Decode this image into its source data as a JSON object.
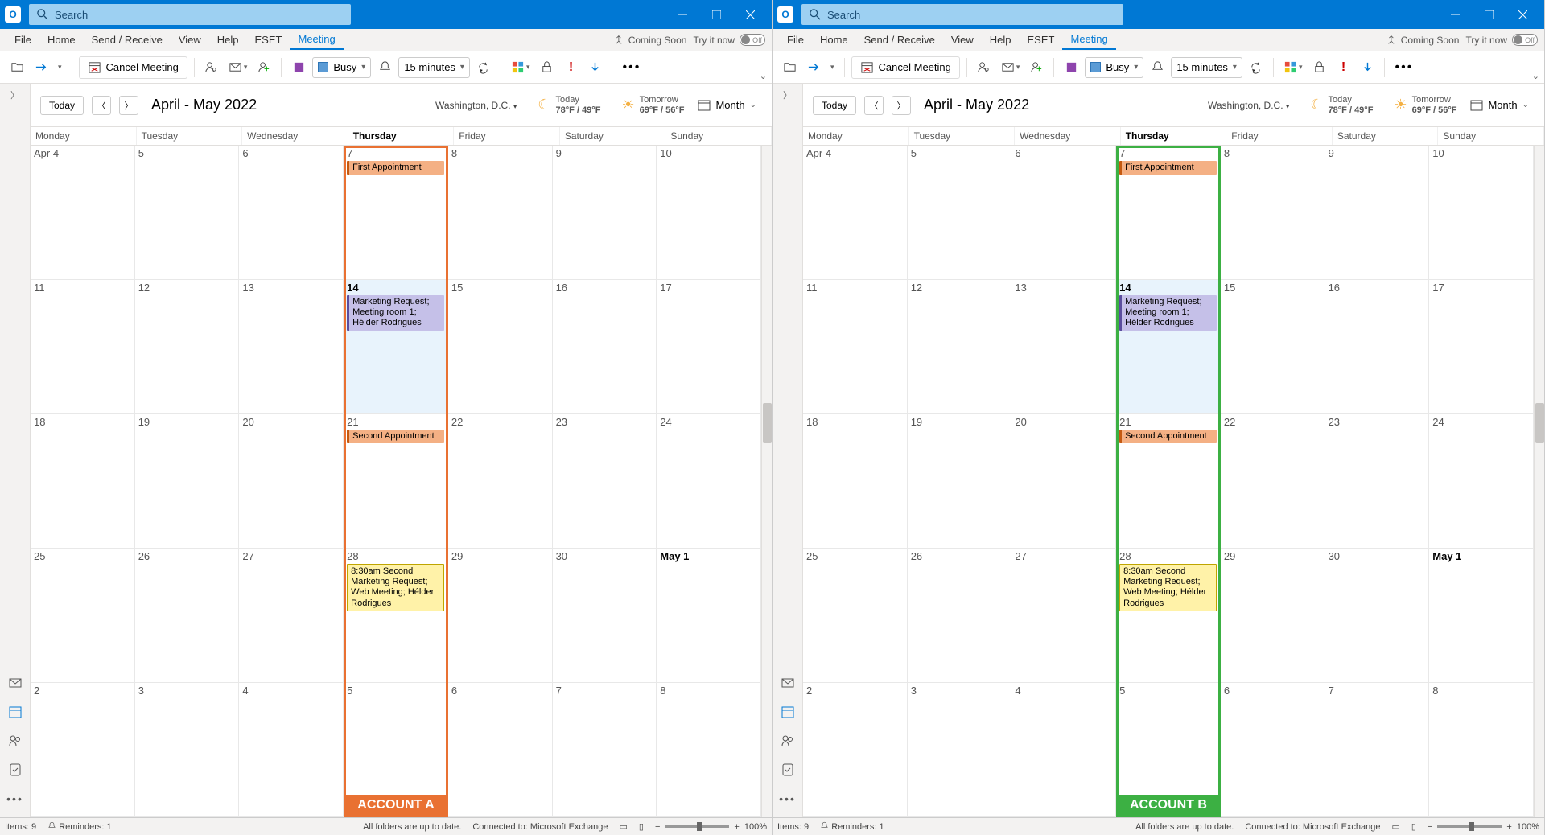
{
  "titlebar": {
    "search_placeholder": "Search"
  },
  "menu": {
    "file": "File",
    "home": "Home",
    "sendreceive": "Send / Receive",
    "view": "View",
    "help": "Help",
    "eset": "ESET",
    "meeting": "Meeting",
    "coming": "Coming Soon",
    "tryit": "Try it now",
    "toggle": "Off"
  },
  "ribbon": {
    "cancel": "Cancel Meeting",
    "busy": "Busy",
    "reminder": "15 minutes"
  },
  "calhdr": {
    "today": "Today",
    "title": "April - May 2022",
    "loc": "Washington, D.C.",
    "w1_label": "Today",
    "w1_temp": "78°F / 49°F",
    "w2_label": "Tomorrow",
    "w2_temp": "69°F / 56°F",
    "view": "Month"
  },
  "days": [
    "Monday",
    "Tuesday",
    "Wednesday",
    "Thursday",
    "Friday",
    "Saturday",
    "Sunday"
  ],
  "cells": [
    [
      "Apr 4",
      "5",
      "6",
      "7",
      "8",
      "9",
      "10"
    ],
    [
      "11",
      "12",
      "13",
      "14",
      "15",
      "16",
      "17"
    ],
    [
      "18",
      "19",
      "20",
      "21",
      "22",
      "23",
      "24"
    ],
    [
      "25",
      "26",
      "27",
      "28",
      "29",
      "30",
      "May 1"
    ],
    [
      "2",
      "3",
      "4",
      "5",
      "6",
      "7",
      "8"
    ]
  ],
  "events": {
    "first": "First Appointment",
    "mkt": "Marketing Request; Meeting room 1; Hélder Rodrigues",
    "second": "Second Appointment",
    "mkt2": "8:30am Second Marketing Request; Web Meeting; Hélder Rodrigues"
  },
  "accountA": {
    "label": "ACCOUNT A",
    "color": "#e97132"
  },
  "accountB": {
    "label": "ACCOUNT B",
    "color": "#3cb043"
  },
  "status": {
    "items": "Items: 9",
    "reminders": "Reminders: 1",
    "folders": "All folders are up to date.",
    "conn": "Connected to: Microsoft Exchange",
    "zoom": "100%"
  }
}
